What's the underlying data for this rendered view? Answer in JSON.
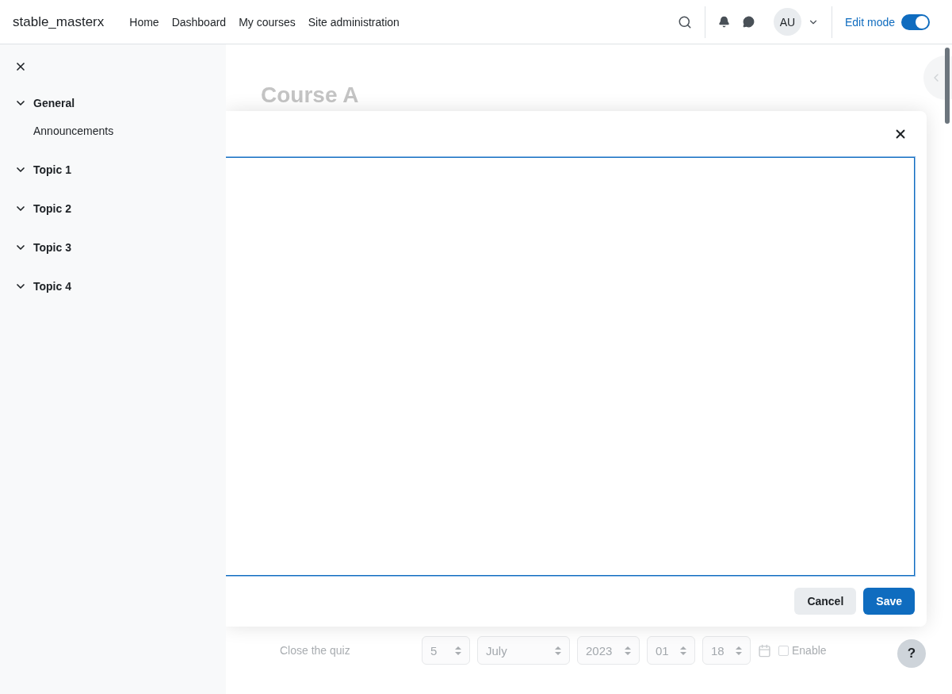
{
  "navbar": {
    "brand": "stable_masterx",
    "links": [
      {
        "label": "Home"
      },
      {
        "label": "Dashboard"
      },
      {
        "label": "My courses"
      },
      {
        "label": "Site administration"
      }
    ],
    "avatar": "AU",
    "edit_mode": {
      "label": "Edit mode",
      "on": true
    }
  },
  "course_index": {
    "items": [
      {
        "label": "General",
        "expanded": true,
        "children": [
          {
            "label": "Announcements"
          }
        ]
      },
      {
        "label": "Topic 1",
        "expanded": true
      },
      {
        "label": "Topic 2",
        "expanded": true
      },
      {
        "label": "Topic 3",
        "expanded": true
      },
      {
        "label": "Topic 4",
        "expanded": true
      }
    ]
  },
  "page": {
    "title": "Course A",
    "close_row": {
      "label": "Close the quiz",
      "selects": [
        "5",
        "July",
        "2023",
        "01",
        "18"
      ],
      "enable": {
        "label": "Enable",
        "checked": false
      }
    }
  },
  "modal": {
    "buttons": [
      {
        "label": "Cancel",
        "kind": "secondary"
      },
      {
        "label": "Save",
        "kind": "primary"
      }
    ]
  },
  "help_button": "?"
}
